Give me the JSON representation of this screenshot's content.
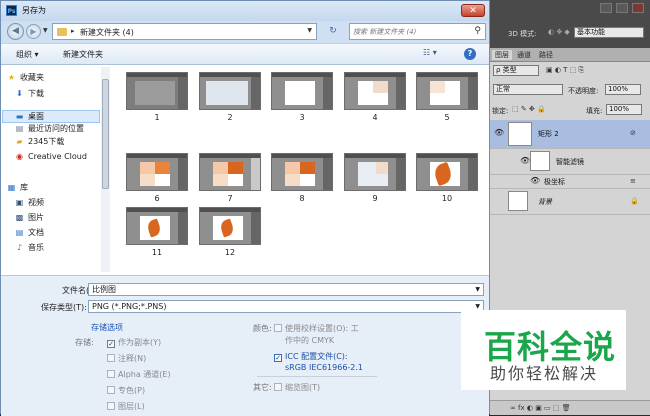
{
  "dialog": {
    "title": "另存为",
    "close_label": "✕",
    "nav": {
      "path": "新建文件夹 (4)",
      "search_placeholder": "搜索 新建文件夹 (4)"
    },
    "toolbar": {
      "organize_label": "组织 ▾",
      "new_folder_label": "新建文件夹",
      "view_label": "☷ ▾",
      "help_label": "?"
    },
    "sidebar": {
      "items": [
        {
          "label": "收藏夹",
          "icon": "star-icon"
        },
        {
          "label": "下载",
          "icon": "download-folder-icon"
        },
        {
          "label": "桌面",
          "icon": "desktop-icon"
        },
        {
          "label": "最近访问的位置",
          "icon": "recent-places-icon"
        },
        {
          "label": "2345下载",
          "icon": "folder-icon"
        },
        {
          "label": "Creative Cloud",
          "icon": "creative-cloud-icon"
        },
        {
          "label": "库",
          "icon": "library-icon"
        },
        {
          "label": "视频",
          "icon": "video-library-icon"
        },
        {
          "label": "图片",
          "icon": "picture-library-icon"
        },
        {
          "label": "文档",
          "icon": "document-library-icon"
        },
        {
          "label": "音乐",
          "icon": "music-library-icon"
        }
      ]
    },
    "files": [
      "1",
      "2",
      "3",
      "4",
      "5",
      "6",
      "7",
      "8",
      "9",
      "10",
      "11",
      "12"
    ],
    "form": {
      "filename_label": "文件名(N):",
      "filename_value": "比例图",
      "filetype_label": "保存类型(T):",
      "filetype_value": "PNG (*.PNG;*.PNS)",
      "save_options_label": "存储选项",
      "save_label": "存储:",
      "as_copy": "作为副本(Y)",
      "notes": "注释(N)",
      "alpha": "Alpha 通道(E)",
      "spot": "专色(P)",
      "layers": "图层(L)",
      "color_label": "颜色:",
      "proof_line1": "使用校样设置(O): 工",
      "proof_line2": "作中的 CMYK",
      "icc_line1": "ICC 配置文件(C):",
      "icc_line2": "sRGB IEC61966-2.1",
      "other_label": "其它:",
      "thumbnail": "缩览图(T)"
    }
  },
  "photoshop": {
    "mode_label": "3D 模式:",
    "workspace": "基本功能",
    "tabs": [
      "图层",
      "通道",
      "路径"
    ],
    "filter_kind": "ρ 类型",
    "blend_mode": "正常",
    "opacity_label": "不透明度:",
    "opacity_value": "100%",
    "lock_label": "锁定:",
    "fill_label": "填充:",
    "fill_value": "100%",
    "layers": [
      {
        "name": "矩形 2"
      },
      {
        "name": "智能滤镜"
      },
      {
        "name": "极坐标"
      },
      {
        "name": "背景"
      }
    ]
  },
  "watermark": {
    "main": "百科全说",
    "sub": "助你轻松解决"
  }
}
